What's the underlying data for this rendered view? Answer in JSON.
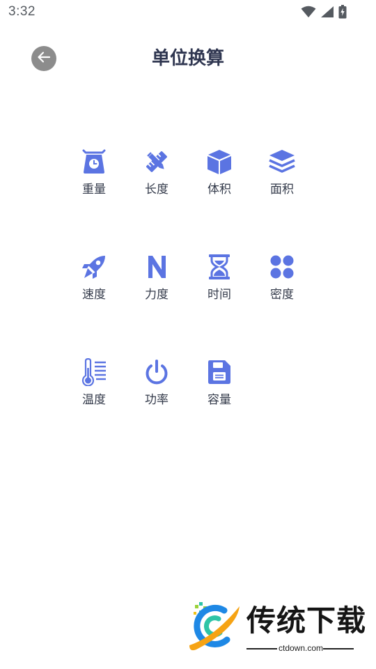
{
  "status_bar": {
    "time": "3:32",
    "icons": [
      "wifi-icon",
      "signal-icon",
      "battery-charging-icon"
    ]
  },
  "header": {
    "back_icon": "arrow-left-icon",
    "title": "单位换算"
  },
  "theme": {
    "icon_color": "#5b74e2",
    "title_color": "#2f3650",
    "back_button_color": "#8c8c8c"
  },
  "categories": [
    {
      "label": "重量",
      "icon": "scale-weight-icon"
    },
    {
      "label": "长度",
      "icon": "ruler-pencil-icon"
    },
    {
      "label": "体积",
      "icon": "cube-icon"
    },
    {
      "label": "面积",
      "icon": "layers-icon"
    },
    {
      "label": "速度",
      "icon": "rocket-icon"
    },
    {
      "label": "力度",
      "icon": "letter-n-icon"
    },
    {
      "label": "时间",
      "icon": "hourglass-icon"
    },
    {
      "label": "密度",
      "icon": "four-dots-icon"
    },
    {
      "label": "温度",
      "icon": "thermometer-icon"
    },
    {
      "label": "功率",
      "icon": "power-icon"
    },
    {
      "label": "容量",
      "icon": "floppy-disk-icon"
    }
  ],
  "watermark": {
    "brand": "传统下载",
    "url": "ctdown.com"
  }
}
